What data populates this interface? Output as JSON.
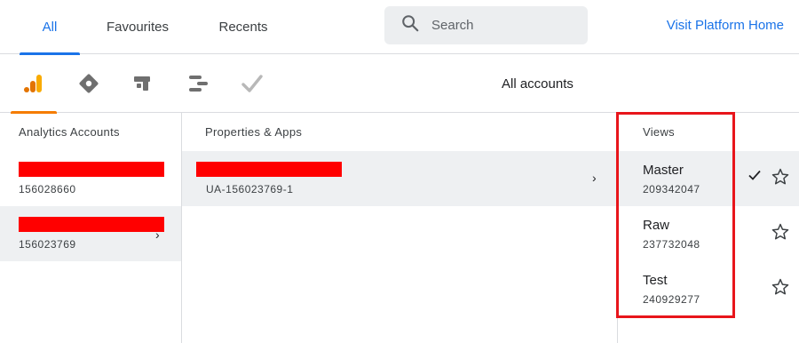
{
  "tabs": [
    {
      "label": "All",
      "active": true
    },
    {
      "label": "Favourites",
      "active": false
    },
    {
      "label": "Recents",
      "active": false
    }
  ],
  "search": {
    "placeholder": "Search",
    "icon": "search-icon"
  },
  "visit_link": "Visit Platform Home",
  "products": [
    {
      "icon": "analytics-icon",
      "active": true,
      "color": "#f57c00"
    },
    {
      "icon": "tag-manager-icon",
      "active": false
    },
    {
      "icon": "optimize-icon",
      "active": false
    },
    {
      "icon": "data-studio-icon",
      "active": false
    },
    {
      "icon": "surveys-icon",
      "active": false
    }
  ],
  "scope_label": "All accounts",
  "columns": {
    "accounts": {
      "header": "Analytics Accounts",
      "rows": [
        {
          "id": "156028660",
          "selected": false,
          "redacted": true
        },
        {
          "id": "156023769",
          "selected": true,
          "redacted": true,
          "chevron": "›"
        }
      ]
    },
    "properties": {
      "header": "Properties & Apps",
      "rows": [
        {
          "id": "UA-156023769-1",
          "selected": true,
          "redacted": true,
          "chevron": "›"
        }
      ]
    },
    "views": {
      "header": "Views",
      "rows": [
        {
          "name": "Master",
          "id": "209342047",
          "selected": true,
          "checked": true
        },
        {
          "name": "Raw",
          "id": "237732048",
          "selected": false,
          "checked": false
        },
        {
          "name": "Test",
          "id": "240929277",
          "selected": false,
          "checked": false
        }
      ]
    }
  },
  "colors": {
    "accent": "#1a73e8",
    "highlight": "#e8151b",
    "redaction": "#ff0000",
    "analytics": "#f57c00"
  }
}
